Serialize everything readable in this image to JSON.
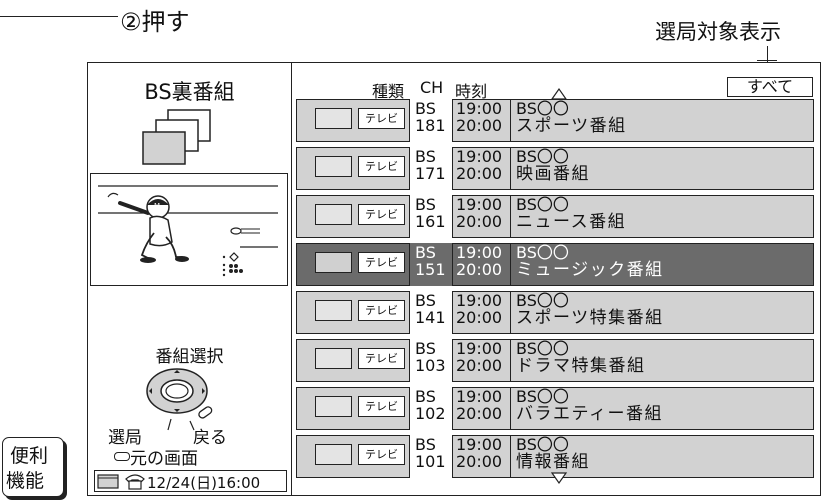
{
  "callouts": {
    "step": "②押す",
    "station_display": "選局対象表示"
  },
  "left_panel": {
    "title": "BS裏番組",
    "select_title": "番組選択",
    "select_label": "選局",
    "back_label": "戻る",
    "original_screen_label": "元の画面",
    "clock": "12/24(日)16:00"
  },
  "header": {
    "type": "種類",
    "ch": "CH",
    "time": "時刻",
    "all_button": "すべて"
  },
  "rows": [
    {
      "type": "テレビ",
      "band": "BS",
      "ch": "181",
      "start": "19:00",
      "end": "20:00",
      "prog1": "BS〇〇",
      "prog2": "スポーツ番組",
      "selected": false
    },
    {
      "type": "テレビ",
      "band": "BS",
      "ch": "171",
      "start": "19:00",
      "end": "20:00",
      "prog1": "BS〇〇",
      "prog2": "映画番組",
      "selected": false
    },
    {
      "type": "テレビ",
      "band": "BS",
      "ch": "161",
      "start": "19:00",
      "end": "20:00",
      "prog1": "BS〇〇",
      "prog2": "ニュース番組",
      "selected": false
    },
    {
      "type": "テレビ",
      "band": "BS",
      "ch": "151",
      "start": "19:00",
      "end": "20:00",
      "prog1": "BS〇〇",
      "prog2": "ミュージック番組",
      "selected": true
    },
    {
      "type": "テレビ",
      "band": "BS",
      "ch": "141",
      "start": "19:00",
      "end": "20:00",
      "prog1": "BS〇〇",
      "prog2": "スポーツ特集番組",
      "selected": false
    },
    {
      "type": "テレビ",
      "band": "BS",
      "ch": "103",
      "start": "19:00",
      "end": "20:00",
      "prog1": "BS〇〇",
      "prog2": "ドラマ特集番組",
      "selected": false
    },
    {
      "type": "テレビ",
      "band": "BS",
      "ch": "102",
      "start": "19:00",
      "end": "20:00",
      "prog1": "BS〇〇",
      "prog2": "バラエティー番組",
      "selected": false
    },
    {
      "type": "テレビ",
      "band": "BS",
      "ch": "101",
      "start": "19:00",
      "end": "20:00",
      "prog1": "BS〇〇",
      "prog2": "情報番組",
      "selected": false
    }
  ],
  "convenience_button": {
    "line1": "便利",
    "line2": "機能"
  },
  "icons": [
    "up-arrow-icon",
    "down-arrow-icon",
    "remote-dpad-icon",
    "mail-icon",
    "phone-icon",
    "multi-screen-icon"
  ],
  "colors": {
    "row_bg": "#d2d2d2",
    "selected_row_bg": "#6b6b6b"
  }
}
